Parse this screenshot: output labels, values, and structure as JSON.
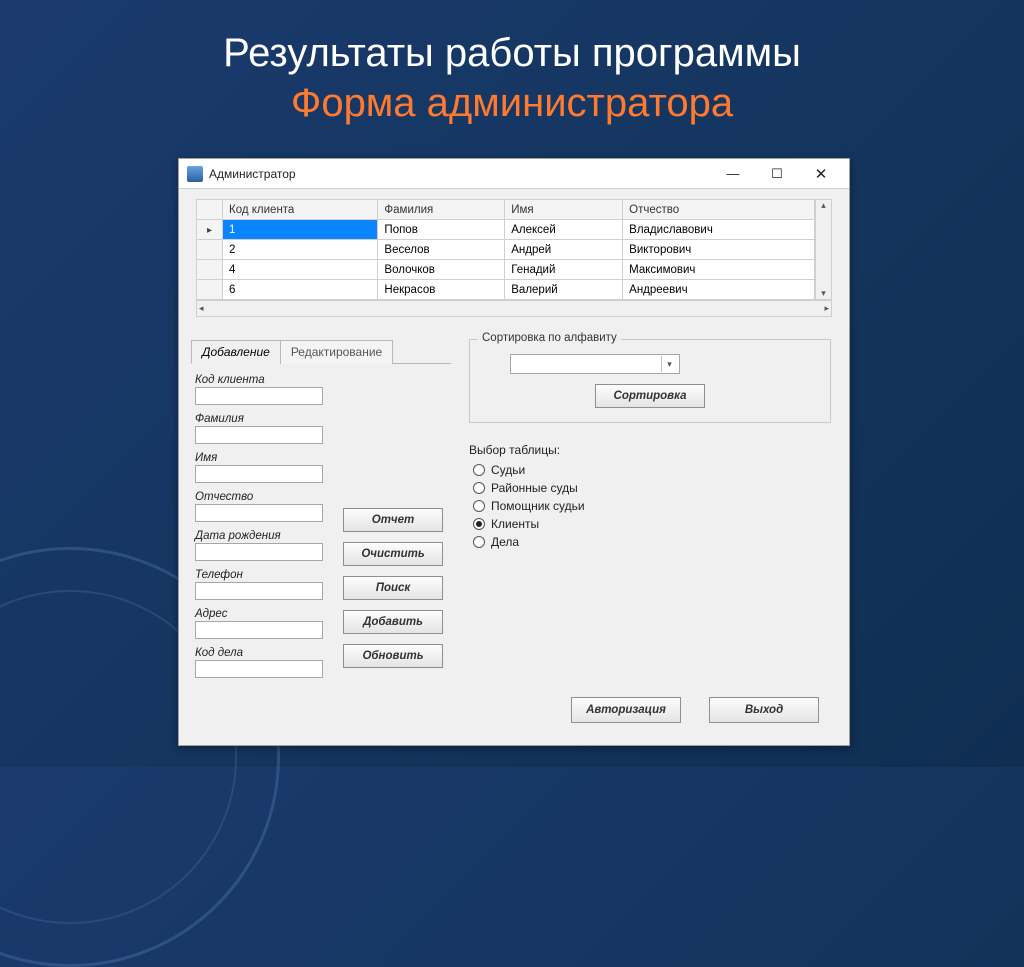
{
  "slide": {
    "title": "Результаты работы программы",
    "subtitle": "Форма администратора"
  },
  "window": {
    "title": "Администратор"
  },
  "grid": {
    "headers": [
      "Код клиента",
      "Фамилия",
      "Имя",
      "Отчество"
    ],
    "rows": [
      {
        "id": "1",
        "last": "Попов",
        "first": "Алексей",
        "patr": "Владиславович",
        "selected": true
      },
      {
        "id": "2",
        "last": "Веселов",
        "first": "Андрей",
        "patr": "Викторович",
        "selected": false
      },
      {
        "id": "4",
        "last": "Волочков",
        "first": "Генадий",
        "patr": "Максимович",
        "selected": false
      },
      {
        "id": "6",
        "last": "Некрасов",
        "first": "Валерий",
        "patr": "Андреевич",
        "selected": false
      }
    ]
  },
  "tabs": {
    "add": "Добавление",
    "edit": "Редактирование"
  },
  "form": {
    "client_id": "Код клиента",
    "lastname": "Фамилия",
    "firstname": "Имя",
    "patronymic": "Отчество",
    "birthdate": "Дата рождения",
    "phone": "Телефон",
    "address": "Адрес",
    "case_id": "Код дела"
  },
  "actions": {
    "report": "Отчет",
    "clear": "Очистить",
    "search": "Поиск",
    "add": "Добавить",
    "update": "Обновить"
  },
  "sort": {
    "group_title": "Сортировка по алфавиту",
    "button": "Сортировка"
  },
  "table_select": {
    "label": "Выбор таблицы:",
    "options": [
      {
        "label": "Судьи",
        "checked": false
      },
      {
        "label": "Районные суды",
        "checked": false
      },
      {
        "label": "Помощник судьи",
        "checked": false
      },
      {
        "label": "Клиенты",
        "checked": true
      },
      {
        "label": "Дела",
        "checked": false
      }
    ]
  },
  "bottom": {
    "auth": "Авторизация",
    "exit": "Выход"
  }
}
